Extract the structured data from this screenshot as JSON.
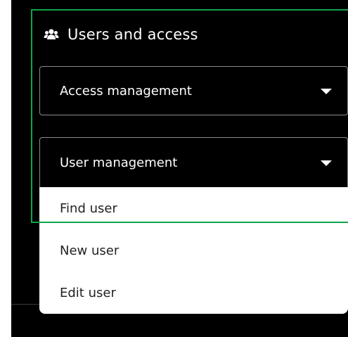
{
  "section": {
    "title": "Users and access",
    "icon": "users-icon"
  },
  "access_select": {
    "label": "Access management",
    "icon": "caret-down-icon"
  },
  "user_select": {
    "label": "User management",
    "icon": "caret-down-icon",
    "options": [
      {
        "label": "Find user"
      },
      {
        "label": "New user"
      },
      {
        "label": "Edit user"
      }
    ]
  },
  "colors": {
    "panel_bg": "#000000",
    "text_light": "#ffffff",
    "menu_bg": "#ffffff",
    "menu_text": "#222222",
    "focus_outline": "#0fa44a",
    "select_border": "#8a8a8a"
  }
}
